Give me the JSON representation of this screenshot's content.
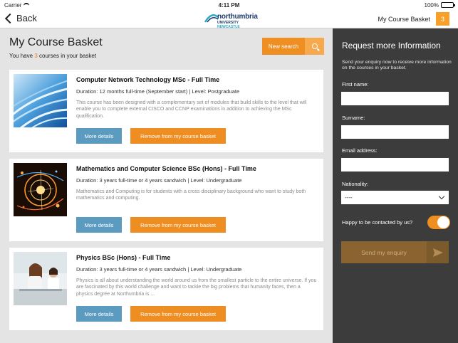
{
  "status_bar": {
    "carrier": "Carrier",
    "time": "4:11 PM",
    "battery": "100%"
  },
  "nav": {
    "back_label": "Back",
    "logo_name": "northumbria",
    "logo_sub_1": "UNIVERSITY",
    "logo_sub_2": "NEWCASTLE",
    "basket_label": "My Course Basket",
    "basket_count": "3"
  },
  "basket": {
    "title": "My Course Basket",
    "subtitle_prefix": "You have",
    "subtitle_count": "3",
    "subtitle_suffix": "courses in your basket",
    "new_search_label": "New search"
  },
  "courses": [
    {
      "title": "Computer Network Technology MSc - Full Time",
      "meta": "Duration: 12 months full-time (September start) | Level: Postgraduate",
      "description": "This course has been designed with a complementary set of modules that build skills to the level that will enable you to complete external CISCO and CCNP examinations in addition to achieving the MSc qualification.",
      "details_label": "More details",
      "remove_label": "Remove from my course basket"
    },
    {
      "title": "Mathematics and Computer Science BSc (Hons) - Full Time",
      "meta": "Duration: 3 years full-time or 4 years sandwich | Level: Undergraduate",
      "description": "Mathematics and Computing is for students with a cross disciplinary background who want to study both mathematics and computing.",
      "details_label": "More details",
      "remove_label": "Remove from my course basket"
    },
    {
      "title": "Physics BSc (Hons) - Full Time",
      "meta": "Duration: 3 years full-time or 4 years sandwich | Level: Undergraduate",
      "description": "Physics is all about understanding the world around us from the smallest particle to the entire universe. If you are fascinated by this world challenge and want to tackle the big problems that humanity faces, then a physics degree at Northumbria is ...",
      "details_label": "More details",
      "remove_label": "Remove from my course basket"
    }
  ],
  "enquiry": {
    "title": "Request more Information",
    "description": "Send your enquiry now to receive more information on the courses in your basket.",
    "first_name_label": "First name:",
    "first_name_value": "",
    "surname_label": "Surname:",
    "surname_value": "",
    "email_label": "Email address:",
    "email_value": "",
    "nationality_label": "Nationality:",
    "nationality_value": "----",
    "contact_label": "Happy to be contacted by us?",
    "contact_on": true,
    "send_label": "Send my enquiry"
  },
  "colors": {
    "accent": "#ef8f22",
    "details_button": "#5b9bc0",
    "panel_bg": "#3c3c3c",
    "send_button": "#8a6330"
  },
  "icons": [
    "wifi-icon",
    "battery-icon",
    "back-chevron-icon",
    "search-icon",
    "chevron-down-icon",
    "send-arrow-icon"
  ]
}
